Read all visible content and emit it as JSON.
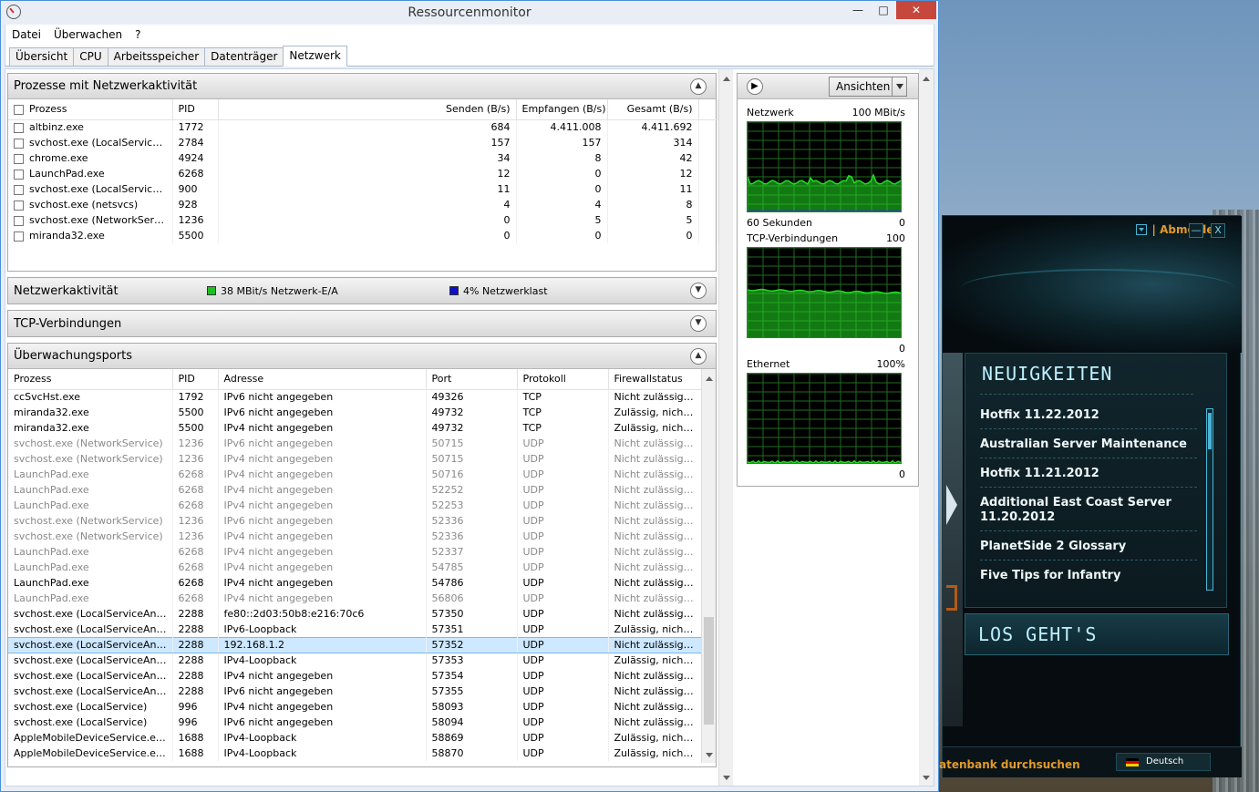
{
  "window": {
    "title": "Ressourcenmonitor",
    "controls": {
      "minimize": "—",
      "maximize": "□",
      "close": "✕"
    }
  },
  "menu": [
    "Datei",
    "Überwachen",
    "?"
  ],
  "tabs": [
    "Übersicht",
    "CPU",
    "Arbeitsspeicher",
    "Datenträger",
    "Netzwerk"
  ],
  "active_tab": "Netzwerk",
  "process_section": {
    "title": "Prozesse mit Netzwerkaktivität",
    "columns": [
      "Prozess",
      "PID",
      "Senden (B/s)",
      "Empfangen (B/s)",
      "Gesamt (B/s)"
    ],
    "rows": [
      {
        "name": "altbinz.exe",
        "pid": "1772",
        "send": "684",
        "recv": "4.411.008",
        "total": "4.411.692"
      },
      {
        "name": "svchost.exe (LocalServicePee...",
        "pid": "2784",
        "send": "157",
        "recv": "157",
        "total": "314"
      },
      {
        "name": "chrome.exe",
        "pid": "4924",
        "send": "34",
        "recv": "8",
        "total": "42"
      },
      {
        "name": "LaunchPad.exe",
        "pid": "6268",
        "send": "12",
        "recv": "0",
        "total": "12"
      },
      {
        "name": "svchost.exe (LocalServiceNet...",
        "pid": "900",
        "send": "11",
        "recv": "0",
        "total": "11"
      },
      {
        "name": "svchost.exe (netsvcs)",
        "pid": "928",
        "send": "4",
        "recv": "4",
        "total": "8"
      },
      {
        "name": "svchost.exe (NetworkService)",
        "pid": "1236",
        "send": "0",
        "recv": "5",
        "total": "5"
      },
      {
        "name": "miranda32.exe",
        "pid": "5500",
        "send": "0",
        "recv": "0",
        "total": "0"
      }
    ]
  },
  "activity_section": {
    "title": "Netzwerkaktivität",
    "io_label": "38 MBit/s Netzwerk-E/A",
    "io_color": "#1fbf1f",
    "load_label": "4% Netzwerklast",
    "load_color": "#1010c8"
  },
  "tcp_section": {
    "title": "TCP-Verbindungen"
  },
  "ports_section": {
    "title": "Überwachungsports",
    "columns": [
      "Prozess",
      "PID",
      "Adresse",
      "Port",
      "Protokoll",
      "Firewallstatus"
    ],
    "rows": [
      {
        "name": "ccSvcHst.exe",
        "pid": "1792",
        "addr": "IPv6 nicht angegeben",
        "port": "49326",
        "proto": "TCP",
        "fw": "Nicht zulässig, ...",
        "dim": false,
        "sel": false
      },
      {
        "name": "miranda32.exe",
        "pid": "5500",
        "addr": "IPv6 nicht angegeben",
        "port": "49732",
        "proto": "TCP",
        "fw": "Zulässig, nicht ...",
        "dim": false,
        "sel": false
      },
      {
        "name": "miranda32.exe",
        "pid": "5500",
        "addr": "IPv4 nicht angegeben",
        "port": "49732",
        "proto": "TCP",
        "fw": "Zulässig, nicht ...",
        "dim": false,
        "sel": false
      },
      {
        "name": "svchost.exe (NetworkService)",
        "pid": "1236",
        "addr": "IPv6 nicht angegeben",
        "port": "50715",
        "proto": "UDP",
        "fw": "Nicht zulässig, ...",
        "dim": true,
        "sel": false
      },
      {
        "name": "svchost.exe (NetworkService)",
        "pid": "1236",
        "addr": "IPv4 nicht angegeben",
        "port": "50715",
        "proto": "UDP",
        "fw": "Nicht zulässig, ...",
        "dim": true,
        "sel": false
      },
      {
        "name": "LaunchPad.exe",
        "pid": "6268",
        "addr": "IPv4 nicht angegeben",
        "port": "50716",
        "proto": "UDP",
        "fw": "Nicht zulässig, ...",
        "dim": true,
        "sel": false
      },
      {
        "name": "LaunchPad.exe",
        "pid": "6268",
        "addr": "IPv4 nicht angegeben",
        "port": "52252",
        "proto": "UDP",
        "fw": "Nicht zulässig, ...",
        "dim": true,
        "sel": false
      },
      {
        "name": "LaunchPad.exe",
        "pid": "6268",
        "addr": "IPv4 nicht angegeben",
        "port": "52253",
        "proto": "UDP",
        "fw": "Nicht zulässig, ...",
        "dim": true,
        "sel": false
      },
      {
        "name": "svchost.exe (NetworkService)",
        "pid": "1236",
        "addr": "IPv6 nicht angegeben",
        "port": "52336",
        "proto": "UDP",
        "fw": "Nicht zulässig, ...",
        "dim": true,
        "sel": false
      },
      {
        "name": "svchost.exe (NetworkService)",
        "pid": "1236",
        "addr": "IPv4 nicht angegeben",
        "port": "52336",
        "proto": "UDP",
        "fw": "Nicht zulässig, ...",
        "dim": true,
        "sel": false
      },
      {
        "name": "LaunchPad.exe",
        "pid": "6268",
        "addr": "IPv4 nicht angegeben",
        "port": "52337",
        "proto": "UDP",
        "fw": "Nicht zulässig, ...",
        "dim": true,
        "sel": false
      },
      {
        "name": "LaunchPad.exe",
        "pid": "6268",
        "addr": "IPv4 nicht angegeben",
        "port": "54785",
        "proto": "UDP",
        "fw": "Nicht zulässig, ...",
        "dim": true,
        "sel": false
      },
      {
        "name": "LaunchPad.exe",
        "pid": "6268",
        "addr": "IPv4 nicht angegeben",
        "port": "54786",
        "proto": "UDP",
        "fw": "Nicht zulässig, ...",
        "dim": false,
        "sel": false
      },
      {
        "name": "LaunchPad.exe",
        "pid": "6268",
        "addr": "IPv4 nicht angegeben",
        "port": "56806",
        "proto": "UDP",
        "fw": "Nicht zulässig, ...",
        "dim": true,
        "sel": false
      },
      {
        "name": "svchost.exe (LocalServiceAndNo...",
        "pid": "2288",
        "addr": "fe80::2d03:50b8:e216:70c6",
        "port": "57350",
        "proto": "UDP",
        "fw": "Nicht zulässig, ...",
        "dim": false,
        "sel": false
      },
      {
        "name": "svchost.exe (LocalServiceAndNo...",
        "pid": "2288",
        "addr": "IPv6-Loopback",
        "port": "57351",
        "proto": "UDP",
        "fw": "Zulässig, nicht ...",
        "dim": false,
        "sel": false
      },
      {
        "name": "svchost.exe (LocalServiceAndNo...",
        "pid": "2288",
        "addr": "192.168.1.2",
        "port": "57352",
        "proto": "UDP",
        "fw": "Nicht zulässig, ...",
        "dim": false,
        "sel": true
      },
      {
        "name": "svchost.exe (LocalServiceAndNo...",
        "pid": "2288",
        "addr": "IPv4-Loopback",
        "port": "57353",
        "proto": "UDP",
        "fw": "Zulässig, nicht ...",
        "dim": false,
        "sel": false
      },
      {
        "name": "svchost.exe (LocalServiceAndNo...",
        "pid": "2288",
        "addr": "IPv4 nicht angegeben",
        "port": "57354",
        "proto": "UDP",
        "fw": "Nicht zulässig, ...",
        "dim": false,
        "sel": false
      },
      {
        "name": "svchost.exe (LocalServiceAndNo...",
        "pid": "2288",
        "addr": "IPv6 nicht angegeben",
        "port": "57355",
        "proto": "UDP",
        "fw": "Nicht zulässig, ...",
        "dim": false,
        "sel": false
      },
      {
        "name": "svchost.exe (LocalService)",
        "pid": "996",
        "addr": "IPv4 nicht angegeben",
        "port": "58093",
        "proto": "UDP",
        "fw": "Nicht zulässig, ...",
        "dim": false,
        "sel": false
      },
      {
        "name": "svchost.exe (LocalService)",
        "pid": "996",
        "addr": "IPv6 nicht angegeben",
        "port": "58094",
        "proto": "UDP",
        "fw": "Nicht zulässig, ...",
        "dim": false,
        "sel": false
      },
      {
        "name": "AppleMobileDeviceService.exe",
        "pid": "1688",
        "addr": "IPv4-Loopback",
        "port": "58869",
        "proto": "UDP",
        "fw": "Zulässig, nicht ...",
        "dim": false,
        "sel": false
      },
      {
        "name": "AppleMobileDeviceService.exe",
        "pid": "1688",
        "addr": "IPv4-Loopback",
        "port": "58870",
        "proto": "UDP",
        "fw": "Zulässig, nicht ...",
        "dim": false,
        "sel": false
      }
    ]
  },
  "graphs": {
    "view_button": "Ansichten",
    "network": {
      "label": "Netzwerk",
      "max": "100 MBit/s",
      "time": "60 Sekunden",
      "min": "0"
    },
    "tcp": {
      "label": "TCP-Verbindungen",
      "max": "100",
      "min": "0"
    },
    "ethernet": {
      "label": "Ethernet",
      "max": "100%",
      "min": "0"
    },
    "line_color": "#22dd22"
  },
  "launcher": {
    "account_link": "| Abmelden",
    "minimize": "—",
    "close": "X",
    "news_title": "NEUIGKEITEN",
    "news": [
      "Hotfix 11.22.2012",
      "Australian Server Maintenance",
      "Hotfix 11.21.2012",
      "Additional East Coast Server 11.20.2012",
      "PlanetSide 2 Glossary",
      "Five Tips for Infantry"
    ],
    "go_label": "LOS GEHT'S",
    "search_text": "atenbank durchsuchen",
    "language": "Deutsch"
  }
}
